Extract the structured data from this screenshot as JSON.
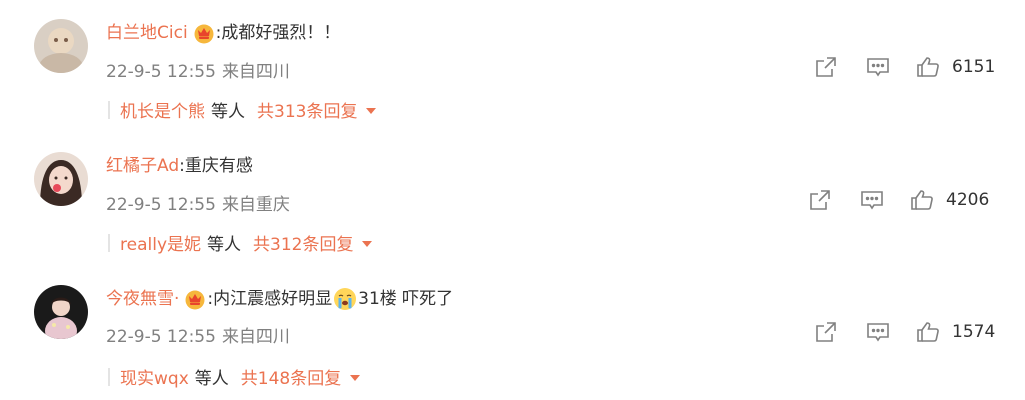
{
  "comments": [
    {
      "username": "白兰地Cici",
      "has_vip_badge": true,
      "text_parts": [
        ":成都好强烈！！"
      ],
      "time": "22-9-5 12:55",
      "source": "来自四川",
      "likes": "6151",
      "reply_user": "机长是个熊",
      "reply_etc": "等人",
      "reply_total": "共313条回复"
    },
    {
      "username": "红橘子Ad",
      "has_vip_badge": false,
      "text_parts": [
        ":重庆有感"
      ],
      "time": "22-9-5 12:55",
      "source": "来自重庆",
      "likes": "4206",
      "reply_user": "really是妮",
      "reply_etc": "等人",
      "reply_total": "共312条回复"
    },
    {
      "username": "今夜無雪·",
      "has_vip_badge": true,
      "text_parts": [
        ":内江震感好明显",
        "31楼 吓死了"
      ],
      "emoji": "crying-face-emoji",
      "time": "22-9-5 12:55",
      "source": "来自四川",
      "likes": "1574",
      "reply_user": "现实wqx",
      "reply_etc": "等人",
      "reply_total": "共148条回复"
    }
  ],
  "icons": {
    "vip": "crown-badge-icon",
    "share": "share-icon",
    "comment": "comment-icon",
    "like": "thumbs-up-icon",
    "expand": "caret-down-icon"
  },
  "colors": {
    "accent": "#eb7350",
    "text": "#333333",
    "meta": "#808080"
  }
}
